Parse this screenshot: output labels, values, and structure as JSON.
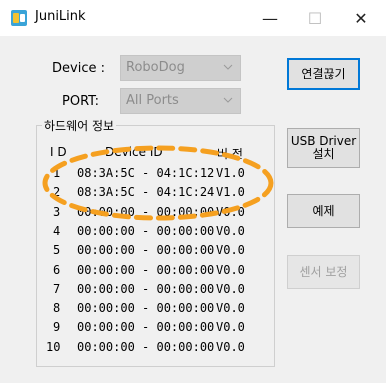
{
  "window": {
    "title": "JuniLink",
    "minimize": "—",
    "maximize": "☐",
    "close": "✕"
  },
  "device": {
    "label": "Device :",
    "value": "RoboDog"
  },
  "port": {
    "label": "PORT:",
    "value": "All Ports"
  },
  "hardware": {
    "group_title": "하드웨어 정보",
    "headers": {
      "id": "I D",
      "device_id": "Device ID",
      "version": "버 전"
    },
    "rows": [
      {
        "id": "1",
        "device_id": "08:3A:5C - 04:1C:12",
        "version": "V1.0"
      },
      {
        "id": "2",
        "device_id": "08:3A:5C - 04:1C:24",
        "version": "V1.0"
      },
      {
        "id": "3",
        "device_id": "00:00:00 - 00:00:00",
        "version": "V0.0"
      },
      {
        "id": "4",
        "device_id": "00:00:00 - 00:00:00",
        "version": "V0.0"
      },
      {
        "id": "5",
        "device_id": "00:00:00 - 00:00:00",
        "version": "V0.0"
      },
      {
        "id": "6",
        "device_id": "00:00:00 - 00:00:00",
        "version": "V0.0"
      },
      {
        "id": "7",
        "device_id": "00:00:00 - 00:00:00",
        "version": "V0.0"
      },
      {
        "id": "8",
        "device_id": "00:00:00 - 00:00:00",
        "version": "V0.0"
      },
      {
        "id": "9",
        "device_id": "00:00:00 - 00:00:00",
        "version": "V0.0"
      },
      {
        "id": "10",
        "device_id": "00:00:00 - 00:00:00",
        "version": "V0.0"
      }
    ]
  },
  "buttons": {
    "disconnect": "연결끊기",
    "usb_driver_line1": "USB Driver",
    "usb_driver_line2": "설치",
    "delete": "예제",
    "sensor_calibration": "센서 보정"
  },
  "colors": {
    "annotation": "#f5a020",
    "accent": "#0078d7"
  }
}
